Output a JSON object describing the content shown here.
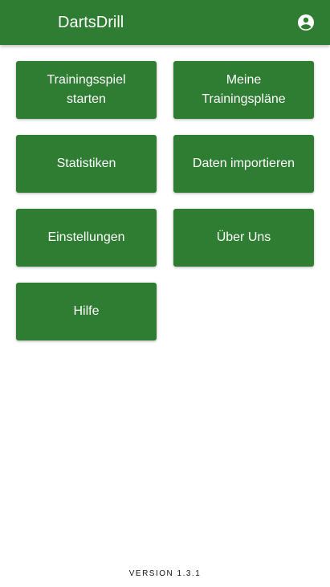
{
  "appbar": {
    "title": "DartsDrill",
    "account_icon": "account-circle-icon"
  },
  "colors": {
    "primary": "#2e7d32",
    "on_primary": "#ffffff",
    "background": "#ffffff"
  },
  "tiles": {
    "training_game": {
      "line1": "Trainingsspiel",
      "line2": "starten"
    },
    "my_plans": {
      "line1": "Meine",
      "line2": "Trainingspläne"
    },
    "statistics": "Statistiken",
    "import_data": "Daten importieren",
    "settings": "Einstellungen",
    "about": "Über Uns",
    "help": "Hilfe"
  },
  "footer": {
    "version": "VERSION 1.3.1"
  }
}
